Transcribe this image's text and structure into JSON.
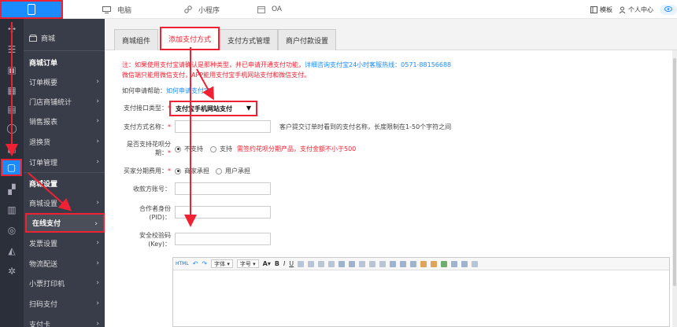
{
  "topbar": {
    "tabs": [
      {
        "icon": "monitor-icon",
        "label": "电脑"
      },
      {
        "icon": "mini-program-icon",
        "label": "小程序"
      },
      {
        "icon": "calendar-icon",
        "label": "OA"
      }
    ],
    "template_label": "模板",
    "user_center_label": "个人中心",
    "pill_label": "●"
  },
  "rail_icons": [
    "puzzle-icon",
    "list-icon",
    "box-icon",
    "grid-icon",
    "image-icon",
    "user-icon",
    "bag-icon",
    "clipboard-icon",
    "apps-icon",
    "doc-icon",
    "chat-icon",
    "compass-icon",
    "gear-icon"
  ],
  "submenu": {
    "title": "商城",
    "items": [
      {
        "label": "商城订单",
        "head": true
      },
      {
        "label": "订单概要",
        "chev": "›"
      },
      {
        "label": "门店商铺统计",
        "chev": "›"
      },
      {
        "label": "销售报表",
        "chev": "›"
      },
      {
        "label": "退换货",
        "chev": "›"
      },
      {
        "label": "订单管理",
        "chev": "›"
      },
      {
        "label": "商城设置",
        "head": true
      },
      {
        "label": "商城设置",
        "chev": "›"
      },
      {
        "label": "在线支付",
        "chev": "›",
        "active": true
      },
      {
        "label": "发票设置",
        "chev": "›"
      },
      {
        "label": "物流配送",
        "chev": "›"
      },
      {
        "label": "小票打印机",
        "chev": "›"
      },
      {
        "label": "扫码支付",
        "chev": "›"
      },
      {
        "label": "支付卡",
        "chev": "›"
      }
    ]
  },
  "tabs": [
    {
      "label": "商城组件"
    },
    {
      "label": "添加支付方式",
      "active": true
    },
    {
      "label": "支付方式管理"
    },
    {
      "label": "商户付款设置"
    }
  ],
  "notice": {
    "line1": "注：如果使用支付宝请确认是那种类型，并已申请开通支付功能，",
    "line1_link": "详细咨询支付宝24小时客服热线：0571-88156688",
    "line2": "微信端只能用微信支付，APP能用支付宝手机网站支付和微信支付。"
  },
  "help": {
    "label": "如何申请帮助：",
    "link": "如何申请支付宝？"
  },
  "form": {
    "pay_type_label": "支付接口类型：",
    "pay_type_value": "支付宝手机网站支付",
    "pay_name_label": "支付方式名称：",
    "pay_name_hint": "客户提交订单时看到的支付名称，长度限制在1-50个字符之间",
    "huabei_label_1": "是否支持花呗分",
    "huabei_label_2": "期：",
    "huabei_no": "不支持",
    "huabei_yes": "支持",
    "huabei_hint": "需签约花呗分期产品，支付金额不小于500",
    "fee_label": "买家分期费用：",
    "fee_merchant": "商家承担",
    "fee_user": "用户承担",
    "account_label": "收款方账号：",
    "pid_label_1": "合作者身份",
    "pid_label_2": "(PID)：",
    "key_label_1": "安全校验码",
    "key_label_2": "(Key)：",
    "required_mark": "*"
  },
  "editor": {
    "toolbar": {
      "html_label": "HTML",
      "undo_label": "↶",
      "redo_label": "↷",
      "font_family": "字体",
      "font_size": "字号",
      "text_a": "A",
      "bold": "B",
      "italic": "I",
      "underline": "U"
    }
  }
}
